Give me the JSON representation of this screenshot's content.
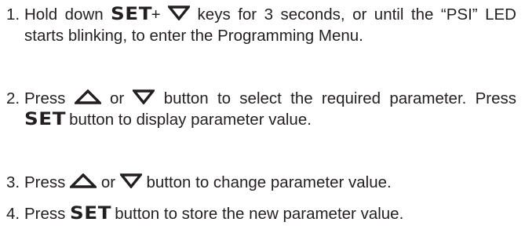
{
  "steps": [
    {
      "number": "1.",
      "line1_a": "Hold down",
      "key_set": "SET",
      "plus": "+",
      "line1_b": "keys for 3 seconds, or until the",
      "rest": "“PSI” LED starts blinking, to enter the Programming Menu."
    },
    {
      "number": "2.",
      "press": "Press",
      "or": "or",
      "text_a": "button to select the required parameter. Press",
      "key_set": "SET",
      "text_b": "button to display parameter value."
    },
    {
      "number": "3.",
      "press": "Press",
      "or": "or",
      "text": "button to change parameter value."
    },
    {
      "number": "4.",
      "press": "Press",
      "key_set": "SET",
      "text": "button to store the new parameter value."
    }
  ],
  "icons": {
    "up": "up-arrow-icon",
    "down": "down-arrow-icon"
  }
}
